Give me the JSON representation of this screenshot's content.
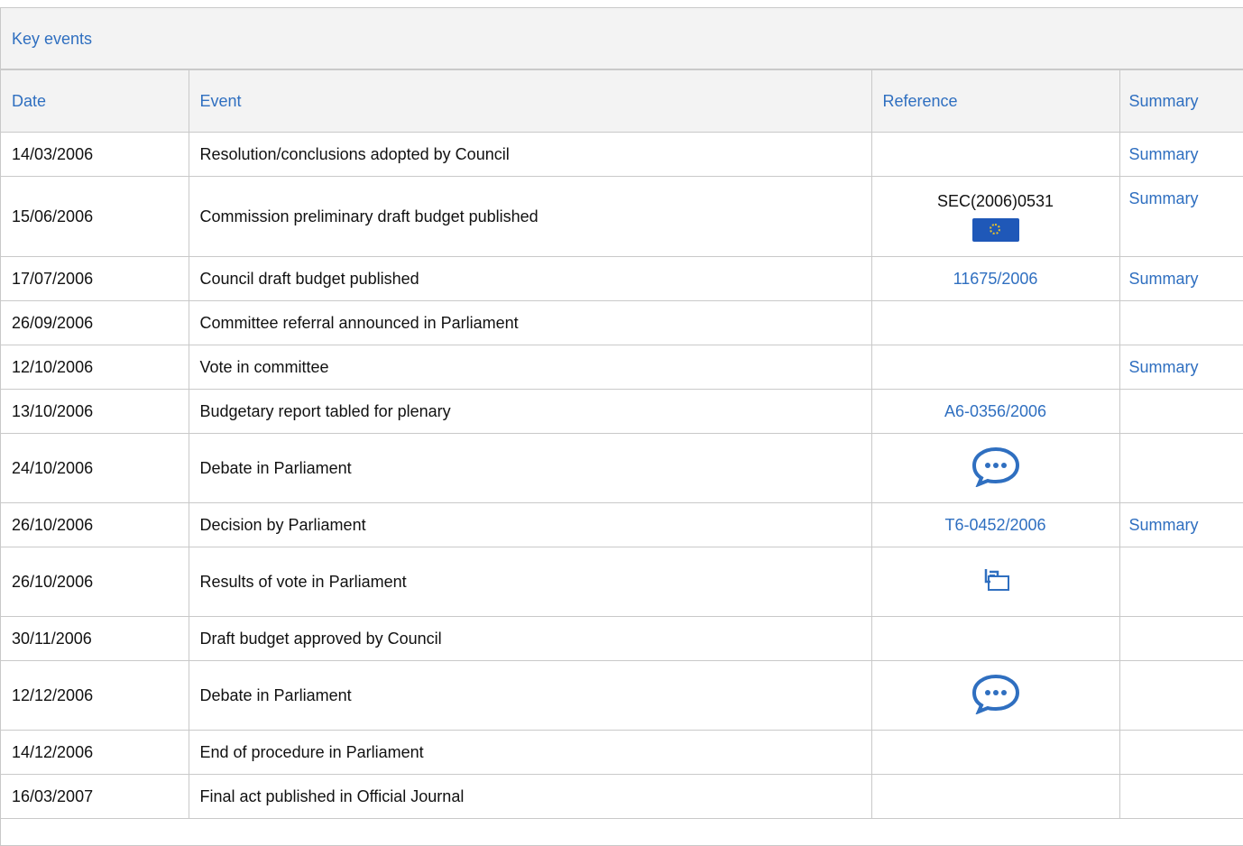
{
  "panel": {
    "title": "Key events"
  },
  "columns": {
    "date": "Date",
    "event": "Event",
    "reference": "Reference",
    "summary": "Summary"
  },
  "rows": [
    {
      "date": "14/03/2006",
      "event": "Resolution/conclusions adopted by Council",
      "reference": "",
      "summary": "Summary"
    },
    {
      "date": "15/06/2006",
      "event": "Commission preliminary draft budget published",
      "reference": "SEC(2006)0531",
      "reference_icon": "eu-flag-icon",
      "summary": "Summary"
    },
    {
      "date": "17/07/2006",
      "event": "Council draft budget published",
      "reference": "11675/2006",
      "summary": "Summary"
    },
    {
      "date": "26/09/2006",
      "event": "Committee referral announced in Parliament",
      "reference": "",
      "summary": ""
    },
    {
      "date": "12/10/2006",
      "event": "Vote in committee",
      "reference": "",
      "summary": "Summary"
    },
    {
      "date": "13/10/2006",
      "event": "Budgetary report tabled for plenary",
      "reference": "A6-0356/2006",
      "summary": ""
    },
    {
      "date": "24/10/2006",
      "event": "Debate in Parliament",
      "reference": "",
      "reference_icon": "debate-speech-bubble-icon",
      "summary": ""
    },
    {
      "date": "26/10/2006",
      "event": "Decision by Parliament",
      "reference": "T6-0452/2006",
      "summary": "Summary"
    },
    {
      "date": "26/10/2006",
      "event": "Results of vote in Parliament",
      "reference": "",
      "reference_icon": "vote-results-icon",
      "summary": ""
    },
    {
      "date": "30/11/2006",
      "event": "Draft budget approved by Council",
      "reference": "",
      "summary": ""
    },
    {
      "date": "12/12/2006",
      "event": "Debate in Parliament",
      "reference": "",
      "reference_icon": "debate-speech-bubble-icon",
      "summary": ""
    },
    {
      "date": "14/12/2006",
      "event": "End of procedure in Parliament",
      "reference": "",
      "summary": ""
    },
    {
      "date": "16/03/2007",
      "event": "Final act published in Official Journal",
      "reference": "",
      "summary": ""
    }
  ],
  "colors": {
    "link": "#2f6fc0",
    "border": "#c9c9c9",
    "header_bg": "#f3f3f3",
    "icon_blue": "#2f6fc0",
    "flag_blue": "#1f58b8",
    "flag_star": "#e8c32a"
  }
}
